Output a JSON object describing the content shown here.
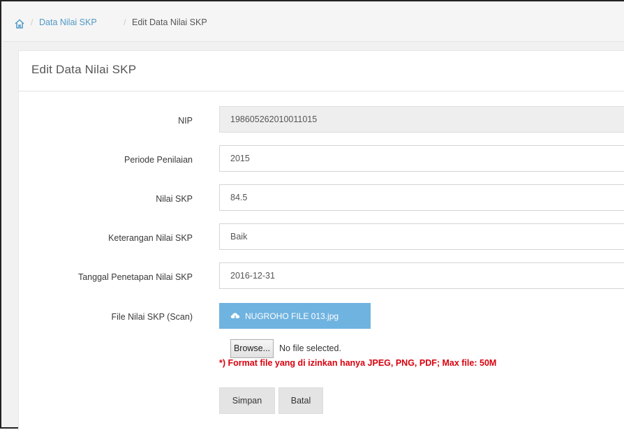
{
  "breadcrumb": {
    "home_icon": "home-icon",
    "separator": "/",
    "link": "Data Nilai SKP",
    "current": "Edit Data Nilai SKP"
  },
  "panel": {
    "title": "Edit Data Nilai SKP"
  },
  "form": {
    "nip": {
      "label": "NIP",
      "value": "198605262010011015"
    },
    "periode": {
      "label": "Periode Penilaian",
      "value": "2015"
    },
    "nilai": {
      "label": "Nilai SKP",
      "value": "84.5"
    },
    "keterangan": {
      "label": "Keterangan Nilai SKP",
      "value": "Baik"
    },
    "tanggal": {
      "label": "Tanggal Penetapan Nilai SKP",
      "value": "2016-12-31"
    },
    "file": {
      "label": "File Nilai SKP (Scan)",
      "current_file": "NUGROHO FILE 013.jpg",
      "icon": "cloud-download-icon",
      "browse_label": "Browse...",
      "no_file_text": "No file selected.",
      "note": "*) Format file yang di izinkan hanya JPEG, PNG, PDF; Max file: 50M"
    }
  },
  "actions": {
    "save": "Simpan",
    "cancel": "Batal"
  },
  "colors": {
    "link": "#4f99c6",
    "file_button": "#6fb3e0",
    "note": "#d9000d"
  }
}
